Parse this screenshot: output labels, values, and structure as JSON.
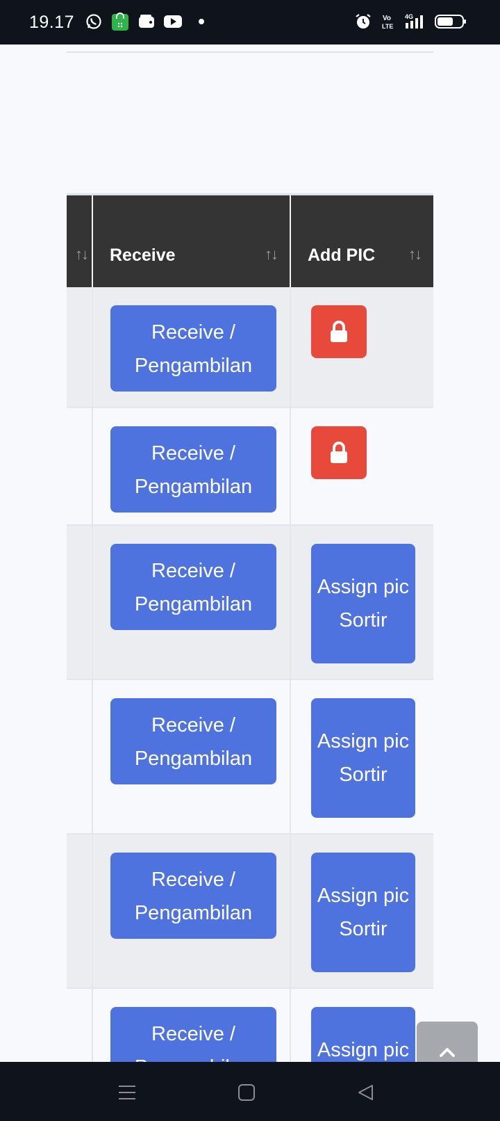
{
  "status_bar": {
    "time": "19.17",
    "left_icons": [
      "whatsapp-icon",
      "store-icon",
      "wallet-icon",
      "youtube-icon",
      "notification-dot-icon"
    ],
    "right_icons": [
      "alarm-icon",
      "volte-icon",
      "signal-4g-icon",
      "battery-icon"
    ],
    "volte_label": "Vo LTE",
    "network_label": "4G"
  },
  "table": {
    "columns": [
      {
        "label": "",
        "sort_icon": "↑↓"
      },
      {
        "label": "Receive",
        "sort_icon": "↑↓"
      },
      {
        "label": "Add PIC",
        "sort_icon": "↑↓"
      }
    ],
    "rows": [
      {
        "receive_label": "Receive / Pengambilan",
        "pic_action": "lock"
      },
      {
        "receive_label": "Receive / Pengambilan",
        "pic_action": "lock"
      },
      {
        "receive_label": "Receive / Pengambilan",
        "pic_action": "assign",
        "assign_label": "Assign pic Sortir"
      },
      {
        "receive_label": "Receive / Pengambilan",
        "pic_action": "assign",
        "assign_label": "Assign pic Sortir"
      },
      {
        "receive_label": "Receive / Pengambilan",
        "pic_action": "assign",
        "assign_label": "Assign pic Sortir"
      },
      {
        "receive_label": "Receive / Pengambilan",
        "pic_action": "assign",
        "assign_label": "Assign pic Sortir"
      }
    ]
  },
  "scroll_to_top": {
    "icon": "chevron-up-icon"
  },
  "nav_bar": {
    "icons": [
      "menu-icon",
      "home-icon",
      "back-icon"
    ]
  },
  "colors": {
    "primary": "#4f73de",
    "danger": "#e74a3b",
    "header_bg": "#343434",
    "system_bar": "#0f131c"
  }
}
